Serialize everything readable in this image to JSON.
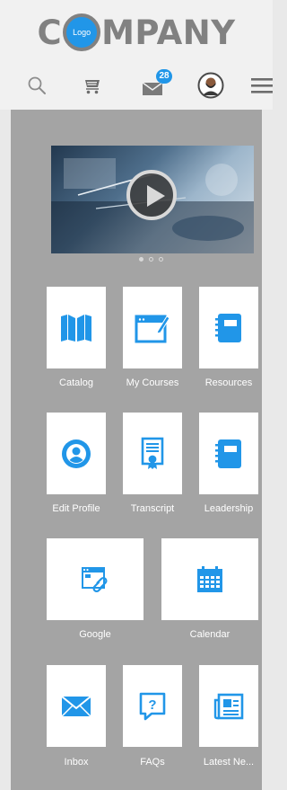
{
  "brand": {
    "before": "C",
    "logo_text": "Logo",
    "after": "MPANY"
  },
  "nav": {
    "items": [
      {
        "name": "search",
        "icon": "search-icon"
      },
      {
        "name": "cart",
        "icon": "cart-icon"
      },
      {
        "name": "mail",
        "icon": "mail-icon",
        "badge": "28"
      },
      {
        "name": "profile",
        "icon": "avatar"
      },
      {
        "name": "menu",
        "icon": "hamburger-menu-icon"
      }
    ]
  },
  "carousel": {
    "icon": "play-icon",
    "slides": 3,
    "active_slide": 1
  },
  "tiles": [
    {
      "label": "Catalog",
      "icon": "book-open-icon"
    },
    {
      "label": "My Courses",
      "icon": "browser-edit-icon"
    },
    {
      "label": "Resources",
      "icon": "notebook-icon"
    },
    {
      "label": "Edit Profile",
      "icon": "user-circle-icon"
    },
    {
      "label": "Transcript",
      "icon": "certificate-icon"
    },
    {
      "label": "Leadership",
      "icon": "notebook-icon"
    },
    {
      "label": "Google",
      "icon": "browser-link-icon"
    },
    {
      "label": "Calendar",
      "icon": "calendar-icon"
    },
    {
      "label": "Inbox",
      "icon": "envelope-icon"
    },
    {
      "label": "FAQs",
      "icon": "question-bubble-icon"
    },
    {
      "label": "Latest Ne...",
      "icon": "newspaper-icon"
    }
  ],
  "colors": {
    "accent": "#2196e8",
    "header_bg": "#f1f1f1",
    "panel_bg": "#a4a4a4",
    "tile_bg": "#ffffff",
    "text_light": "#ffffff",
    "brand_gray": "#818181"
  }
}
